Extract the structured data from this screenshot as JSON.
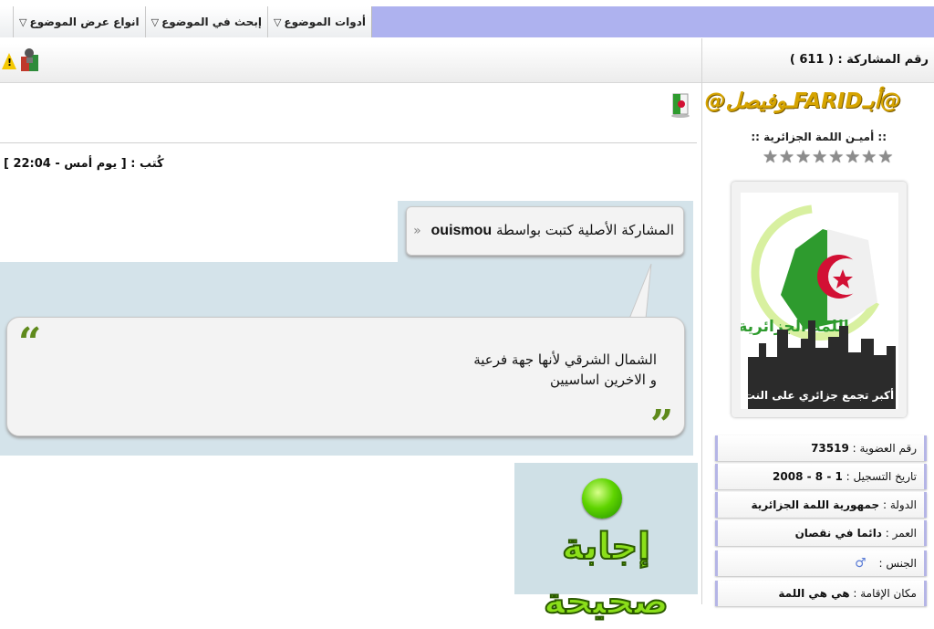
{
  "toolbar": {
    "tools": [
      {
        "label": "أدوات الموضوع"
      },
      {
        "label": "إبحث في الموضوع"
      },
      {
        "label": "انواع عرض الموضوع"
      }
    ]
  },
  "post": {
    "number_label": "رقم المشاركة : ( 611 )",
    "written_label": "كُتب : [ يوم أمس - 22:04 ]",
    "quote_original": {
      "prefix": "المشاركة الأصلية كتبت بواسطة",
      "author": "ouismou"
    },
    "quote_lines": [
      "الشمال الشرقي لأنها جهة فرعية",
      "و الاخرين اساسيين"
    ],
    "answer_badge": "إجابة صحيحة"
  },
  "user": {
    "name": "@أبـFARIDـوفيصل@",
    "title": ":: أميـن اللمة الجزائرية ::",
    "stars": 8,
    "avatar_text": {
      "top": "اللمة الجزائرية",
      "bottom": "أكبر تجمع جزائري على النت"
    },
    "info": [
      {
        "key": "رقم العضوية :",
        "value": "73519"
      },
      {
        "key": "تاريخ التسجيل :",
        "value": "1 - 8 - 2008"
      },
      {
        "key": "الدولة :",
        "value": "جمهورية اللمة الجزائرية"
      },
      {
        "key": "العمر :",
        "value": "دائما في نقصان"
      },
      {
        "key": "الجنس :",
        "value": ""
      },
      {
        "key": "مكان الإقامة :",
        "value": "هي هي اللمة"
      }
    ]
  },
  "colors": {
    "toolbar_blue": "#aeb2ef",
    "quote_bg": "#d4e3ea",
    "username_gold": "#d6a400",
    "algeria_green": "#2e9b2e",
    "algeria_red": "#d21034"
  },
  "icons": {
    "warning": "warning-icon",
    "report": "report-post-icon",
    "flag": "flag-icon",
    "gender": "male-icon",
    "dropdown": "triangle-down-icon"
  }
}
